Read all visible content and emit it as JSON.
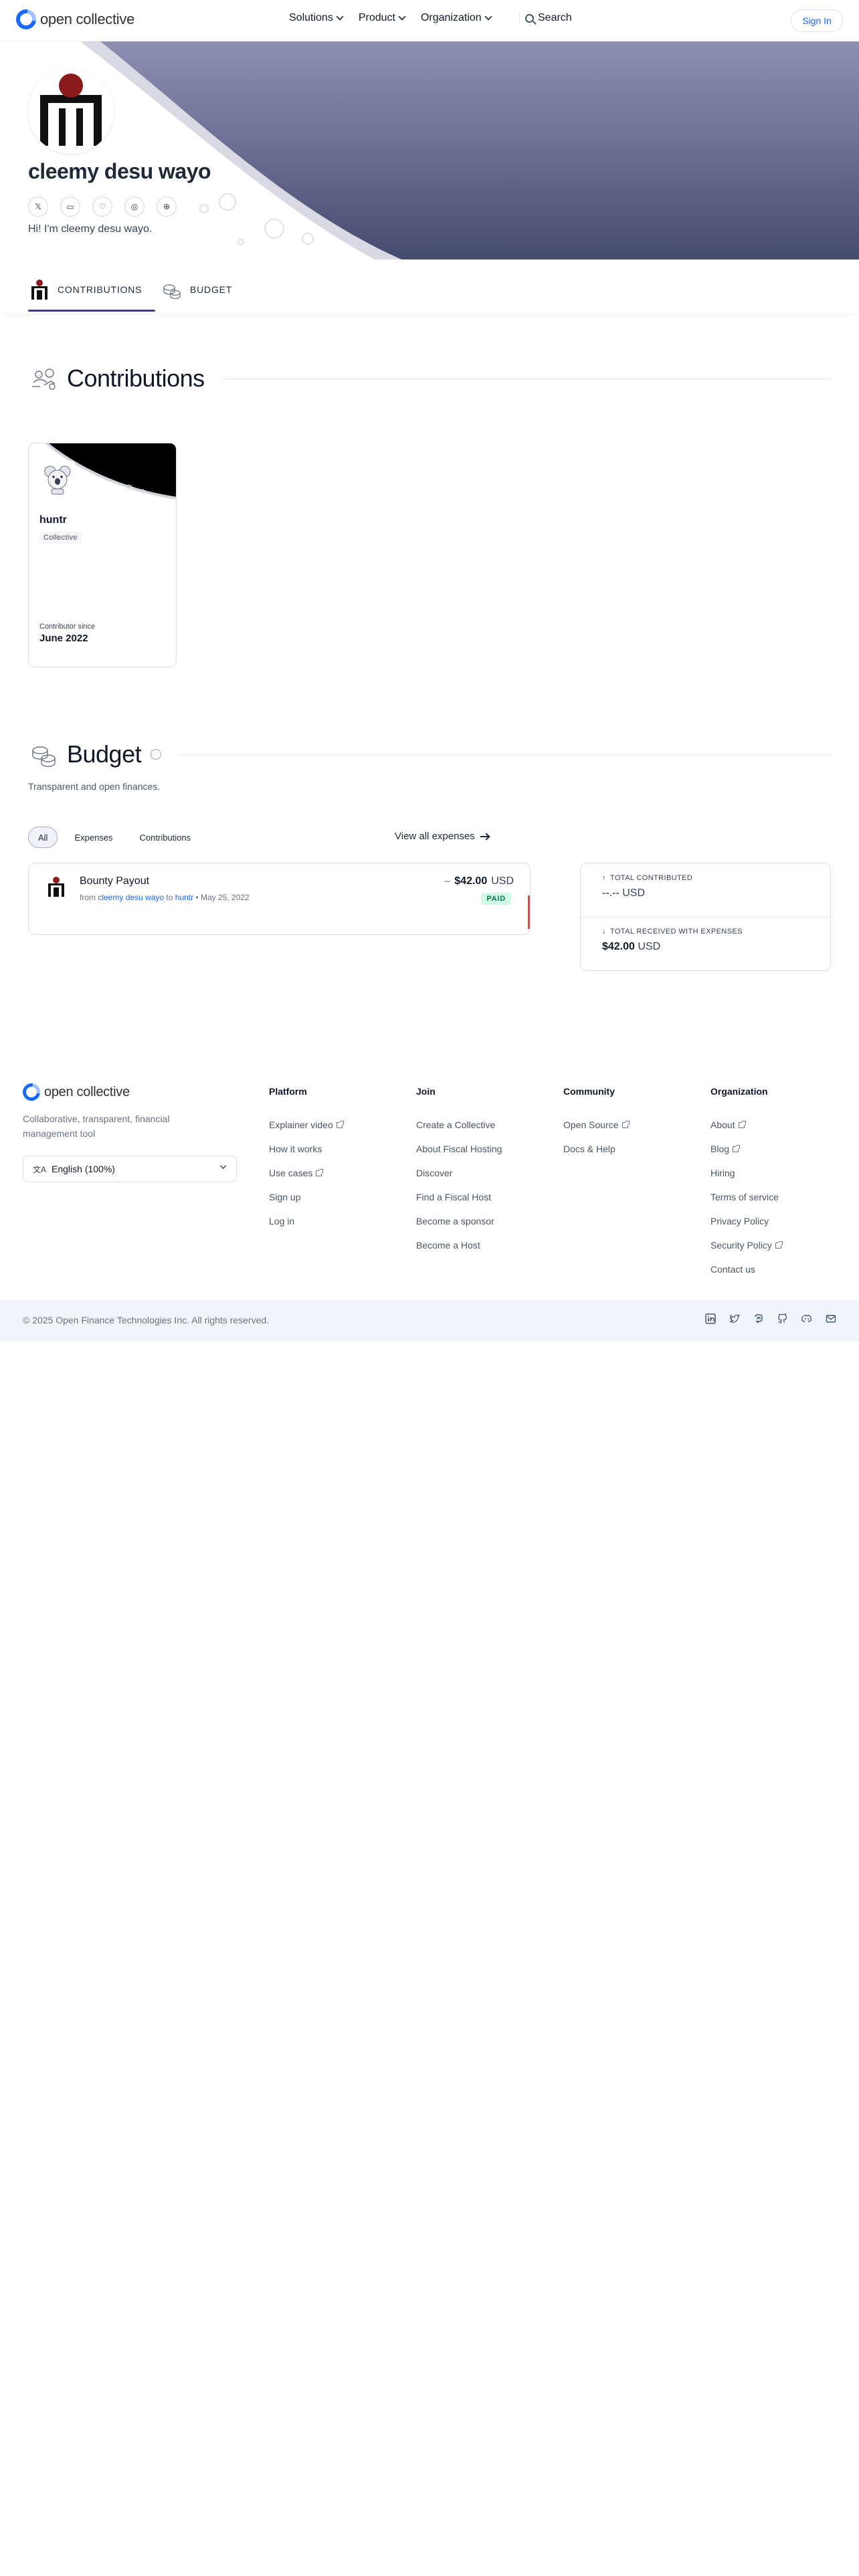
{
  "nav": {
    "brand": "open collective",
    "menu": [
      "Solutions",
      "Product",
      "Organization"
    ],
    "search_label": "Search",
    "signin_label": "Sign In"
  },
  "profile": {
    "name": "cleemy desu wayo",
    "bio": "Hi! I'm cleemy desu wayo.",
    "social_icons": [
      "x-icon",
      "message-icon",
      "heart-icon",
      "globe-icon",
      "website-icon"
    ]
  },
  "tabs": [
    {
      "label": "CONTRIBUTIONS",
      "active": true
    },
    {
      "label": "BUDGET",
      "active": false
    }
  ],
  "contributions": {
    "title": "Contributions",
    "cards": [
      {
        "name": "huntr",
        "type": "Collective",
        "since_label": "Contributor since",
        "since": "June 2022"
      }
    ]
  },
  "budget": {
    "title": "Budget",
    "description": "Transparent and open finances.",
    "filters": [
      "All",
      "Expenses",
      "Contributions"
    ],
    "active_filter": "All",
    "view_all_label": "View all expenses",
    "expenses": [
      {
        "title": "Bounty Payout",
        "from_prefix": "from",
        "from": "cleemy desu wayo",
        "to_prefix": "to",
        "to": "huntr",
        "date": "May 25, 2022",
        "sign": "–",
        "amount": "$42.00",
        "currency": "USD",
        "status": "PAID"
      }
    ],
    "totals": {
      "contributed_label": "TOTAL CONTRIBUTED",
      "contributed_value": "--.--",
      "contributed_currency": "USD",
      "received_label": "TOTAL RECEIVED WITH EXPENSES",
      "received_value": "$42.00",
      "received_currency": "USD"
    }
  },
  "footer": {
    "brand": "open collective",
    "tagline": "Collaborative, transparent, financial management tool",
    "language": "English (100%)",
    "columns": [
      {
        "title": "Platform",
        "links": [
          {
            "label": "Explainer video",
            "external": true
          },
          {
            "label": "How it works",
            "external": false
          },
          {
            "label": "Use cases",
            "external": true
          },
          {
            "label": "Sign up",
            "external": false
          },
          {
            "label": "Log in",
            "external": false
          }
        ]
      },
      {
        "title": "Join",
        "links": [
          {
            "label": "Create a Collective",
            "external": false
          },
          {
            "label": "About Fiscal Hosting",
            "external": false
          },
          {
            "label": "Discover",
            "external": false
          },
          {
            "label": "Find a Fiscal Host",
            "external": false
          },
          {
            "label": "Become a sponsor",
            "external": false
          },
          {
            "label": "Become a Host",
            "external": false
          }
        ]
      },
      {
        "title": "Community",
        "links": [
          {
            "label": "Open Source",
            "external": true
          },
          {
            "label": "Docs & Help",
            "external": false
          }
        ]
      },
      {
        "title": "Organization",
        "links": [
          {
            "label": "About",
            "external": true
          },
          {
            "label": "Blog",
            "external": true
          },
          {
            "label": "Hiring",
            "external": false
          },
          {
            "label": "Terms of service",
            "external": false
          },
          {
            "label": "Privacy Policy",
            "external": false
          },
          {
            "label": "Security Policy",
            "external": true
          },
          {
            "label": "Contact us",
            "external": false
          }
        ]
      }
    ],
    "copyright": "© 2025 Open Finance Technologies Inc. All rights reserved.",
    "social_icons": [
      "linkedin-icon",
      "twitter-icon",
      "mastodon-icon",
      "github-icon",
      "discord-icon",
      "mail-icon"
    ]
  },
  "colors": {
    "brand_blue": "#1869f5",
    "hero_gradient_top": "#8e8fb3",
    "hero_gradient_bottom": "#474a6f",
    "tab_underline": "#3d3f8a",
    "paid_green": "#047857"
  }
}
